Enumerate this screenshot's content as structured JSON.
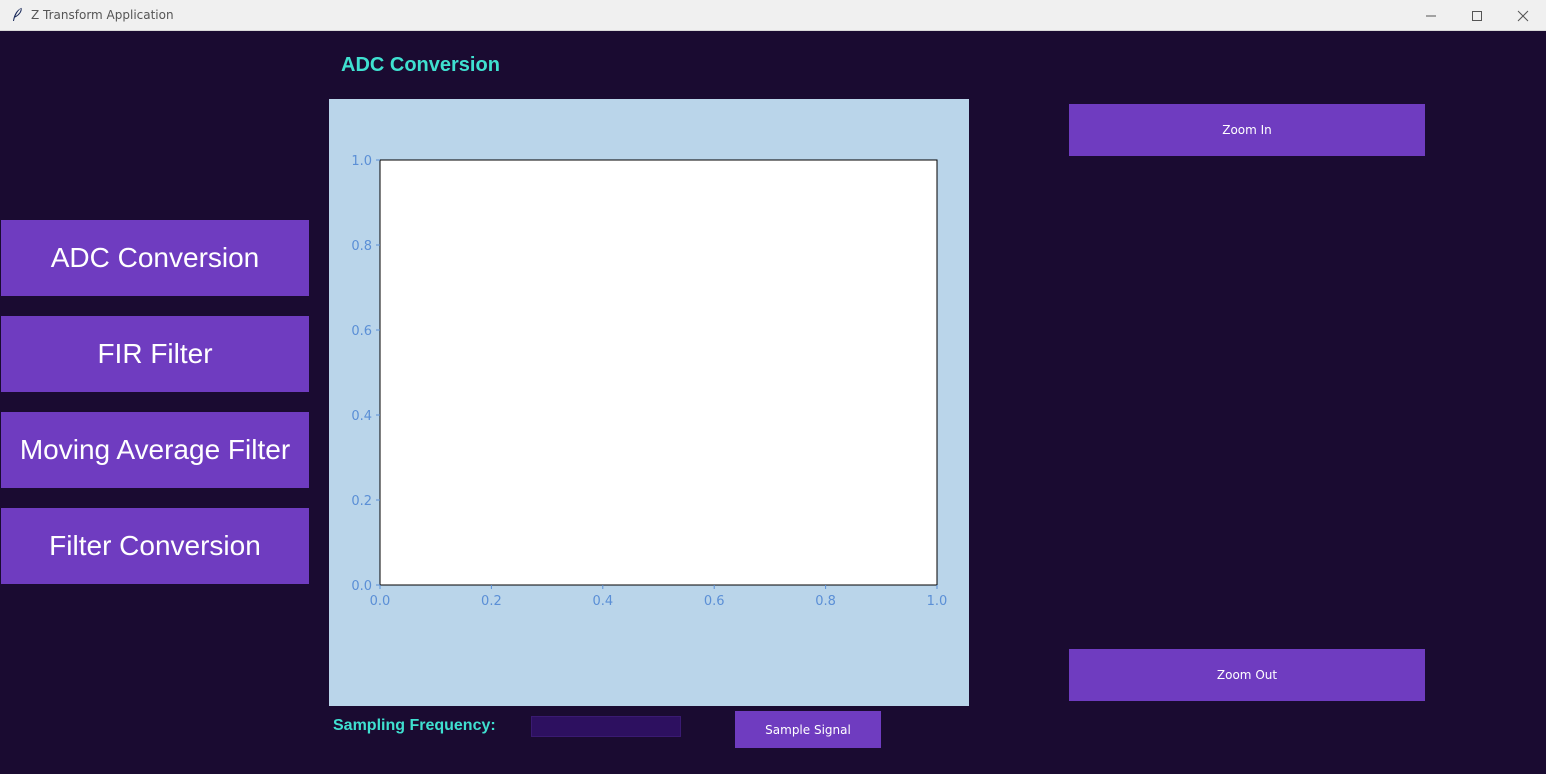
{
  "window": {
    "title": "Z Transform Application",
    "icons": [
      "feather-icon",
      "minimize-icon",
      "maximize-icon",
      "close-icon"
    ]
  },
  "header": {
    "title": "ADC Conversion"
  },
  "nav": {
    "items": [
      {
        "label": "ADC Conversion"
      },
      {
        "label": "FIR Filter"
      },
      {
        "label": "Moving Average Filter"
      },
      {
        "label": "Filter Conversion"
      }
    ]
  },
  "zoom": {
    "in_label": "Zoom In",
    "out_label": "Zoom Out"
  },
  "sampling": {
    "label": "Sampling Frequency:",
    "value": "",
    "button_label": "Sample Signal"
  },
  "colors": {
    "background": "#1a0b31",
    "button": "#6f3cc0",
    "heading": "#3fe0d0",
    "plot_panel": "#bad5ea",
    "tick_label": "#5b8fd6"
  },
  "chart_data": {
    "type": "line",
    "title": "",
    "xlabel": "",
    "ylabel": "",
    "series": [],
    "xlim": [
      0.0,
      1.0
    ],
    "ylim": [
      0.0,
      1.0
    ],
    "xticks": [
      "0.0",
      "0.2",
      "0.4",
      "0.6",
      "0.8",
      "1.0"
    ],
    "yticks": [
      "0.0",
      "0.2",
      "0.4",
      "0.6",
      "0.8",
      "1.0"
    ],
    "grid": false
  }
}
